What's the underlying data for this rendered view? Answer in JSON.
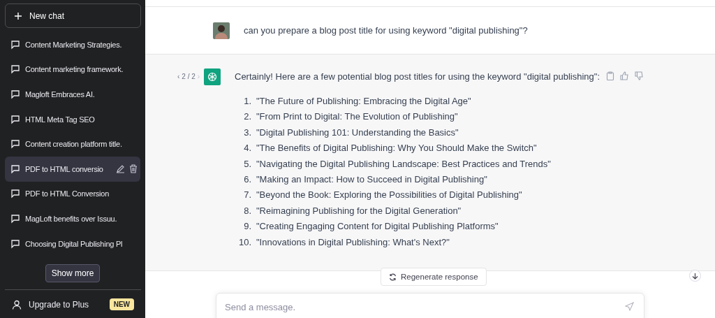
{
  "sidebar": {
    "new_chat": {
      "label": "New chat"
    },
    "items": [
      {
        "label": "Content Marketing Strategies.",
        "selected": false
      },
      {
        "label": "Content marketing framework.",
        "selected": false
      },
      {
        "label": "Magloft Embraces AI.",
        "selected": false
      },
      {
        "label": "HTML Meta Tag SEO",
        "selected": false
      },
      {
        "label": "Content creation platform title.",
        "selected": false
      },
      {
        "label": "PDF to HTML conversio",
        "selected": true
      },
      {
        "label": "PDF to HTML Conversion",
        "selected": false
      },
      {
        "label": "MagLoft benefits over Issuu.",
        "selected": false
      },
      {
        "label": "Choosing Digital Publishing Pl",
        "selected": false
      }
    ],
    "show_more": "Show more",
    "upgrade": {
      "label": "Upgrade to Plus",
      "badge": "NEW"
    }
  },
  "conversation": {
    "user_message": "can you prepare a blog post title for using keyword \"digital publishing\"?",
    "pager_previous": "‹",
    "pager": "2 / 2",
    "pager_next": "›",
    "assistant_intro": "Certainly! Here are a few potential blog post titles for using the keyword \"digital publishing\":",
    "list": [
      {
        "number": "1.",
        "text": "\"The Future of Publishing: Embracing the Digital Age\""
      },
      {
        "number": "2.",
        "text": "\"From Print to Digital: The Evolution of Publishing\""
      },
      {
        "number": "3.",
        "text": "\"Digital Publishing 101: Understanding the Basics\""
      },
      {
        "number": "4.",
        "text": "\"The Benefits of Digital Publishing: Why You Should Make the Switch\""
      },
      {
        "number": "5.",
        "text": "\"Navigating the Digital Publishing Landscape: Best Practices and Trends\""
      },
      {
        "number": "6.",
        "text": "\"Making an Impact: How to Succeed in Digital Publishing\""
      },
      {
        "number": "7.",
        "text": "\"Beyond the Book: Exploring the Possibilities of Digital Publishing\""
      },
      {
        "number": "8.",
        "text": "\"Reimagining Publishing for the Digital Generation\""
      },
      {
        "number": "9.",
        "text": "\"Creating Engaging Content for Digital Publishing Platforms\""
      },
      {
        "number": "10.",
        "text": "\"Innovations in Digital Publishing: What's Next?\""
      }
    ]
  },
  "regenerate": "Regenerate response",
  "composer": {
    "placeholder": "Send a message."
  }
}
